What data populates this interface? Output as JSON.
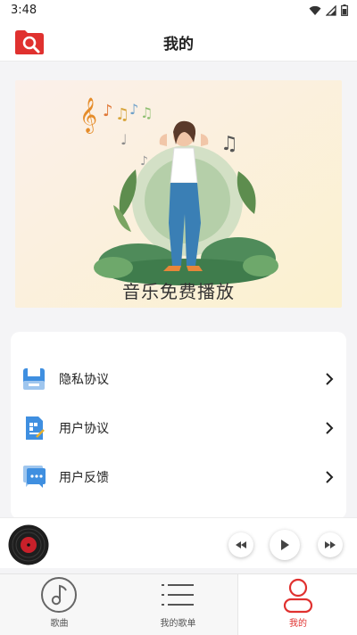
{
  "status": {
    "time": "3:48"
  },
  "header": {
    "title": "我的"
  },
  "banner": {
    "caption": "音乐免费播放"
  },
  "menu": {
    "items": [
      {
        "label": "隐私协议",
        "icon": "shield-doc-icon"
      },
      {
        "label": "用户协议",
        "icon": "document-icon"
      },
      {
        "label": "用户反馈",
        "icon": "chat-bubble-icon"
      }
    ]
  },
  "tabs": [
    {
      "label": "歌曲",
      "icon": "music-note-icon",
      "active": false
    },
    {
      "label": "我的歌单",
      "icon": "list-icon",
      "active": false
    },
    {
      "label": "我的",
      "icon": "user-icon",
      "active": true
    }
  ],
  "colors": {
    "accent": "#e0312f",
    "background": "#f4f4f6"
  }
}
